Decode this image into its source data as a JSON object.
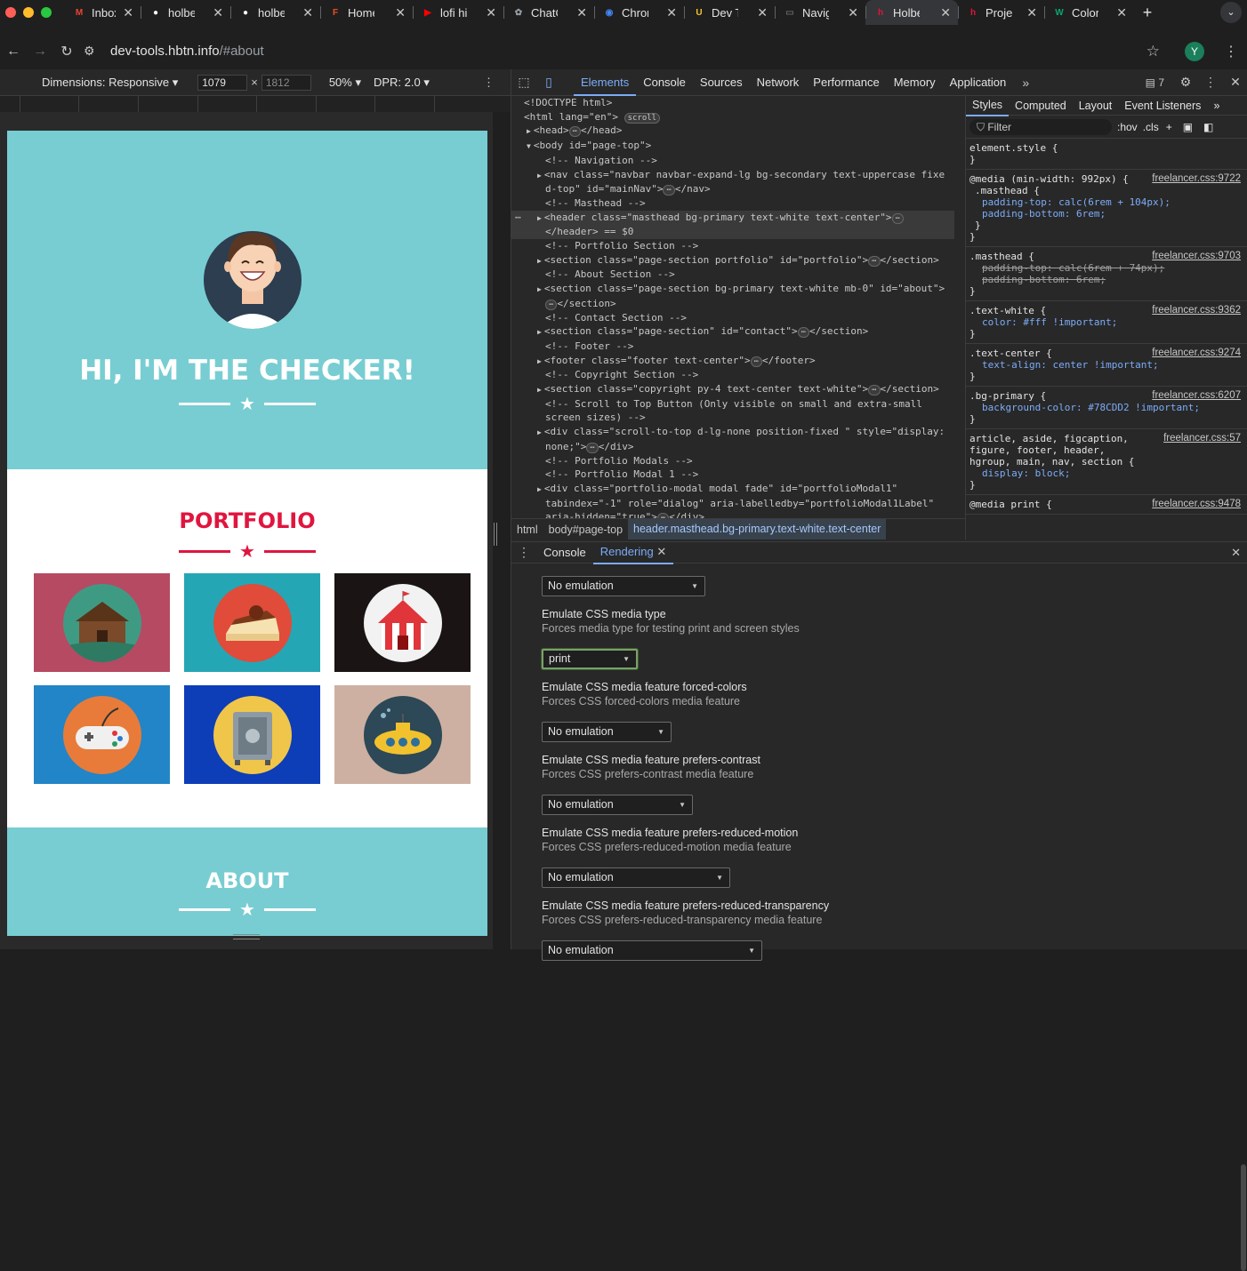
{
  "browser": {
    "tabs": [
      {
        "title": "Inbox",
        "icon": "gmail-icon",
        "color": "#ea4335",
        "glyph": "M"
      },
      {
        "title": "holbe",
        "icon": "github-icon",
        "color": "#ffffff",
        "glyph": "●"
      },
      {
        "title": "holbe",
        "icon": "github-icon",
        "color": "#ffffff",
        "glyph": "●"
      },
      {
        "title": "Home",
        "icon": "figma-icon",
        "color": "#f24e1e",
        "glyph": "F"
      },
      {
        "title": "lofi hi",
        "icon": "youtube-icon",
        "color": "#ff0000",
        "glyph": "▶"
      },
      {
        "title": "ChatC",
        "icon": "openai-icon",
        "color": "#9aa0a6",
        "glyph": "✿"
      },
      {
        "title": "Chror",
        "icon": "chrome-icon",
        "color": "#4285f4",
        "glyph": "◉"
      },
      {
        "title": "Dev T",
        "icon": "udemy-icon",
        "color": "#f4c430",
        "glyph": "U"
      },
      {
        "title": "Navig",
        "icon": "book-icon",
        "color": "#5f6368",
        "glyph": "▭"
      },
      {
        "title": "Holbe",
        "icon": "holberton-icon",
        "color": "#e0153f",
        "glyph": "h",
        "active": true
      },
      {
        "title": "Proje",
        "icon": "holberton-icon",
        "color": "#e0153f",
        "glyph": "h"
      },
      {
        "title": "Color",
        "icon": "w3-icon",
        "color": "#04aa6d",
        "glyph": "W"
      }
    ],
    "new_tab": "+",
    "url_host": "dev-tools.hbtn.info",
    "url_path": "/#about",
    "profile": "Y"
  },
  "device_toolbar": {
    "dimensions_label": "Dimensions: Responsive",
    "width": "1079",
    "times": "×",
    "height": "1812",
    "zoom": "50%",
    "dpr": "DPR: 2.0"
  },
  "site": {
    "hero_title": "HI, I'M THE CHECKER!",
    "portfolio_title": "PORTFOLIO",
    "about_title": "ABOUT",
    "colors": {
      "primary": "#78CDD2",
      "secondary": "#E0153F"
    },
    "tiles": [
      {
        "name": "cabin",
        "bg": "#b64a62",
        "circle": "#3f9a84"
      },
      {
        "name": "cake",
        "bg": "#25a6b5",
        "circle": "#e04b3a"
      },
      {
        "name": "circus",
        "bg": "#1a1414",
        "circle": "#f2f2f2"
      },
      {
        "name": "game-controller",
        "bg": "#2285c7",
        "circle": "#e87b3a"
      },
      {
        "name": "safe",
        "bg": "#0e3db8",
        "circle": "#f0c64a"
      },
      {
        "name": "submarine",
        "bg": "#cdb0a2",
        "circle": "#2d4856"
      }
    ]
  },
  "devtools": {
    "main_tabs": [
      "Elements",
      "Console",
      "Sources",
      "Network",
      "Performance",
      "Memory",
      "Application"
    ],
    "issues_count": "7",
    "dom_lines": [
      "<!DOCTYPE html>",
      "<html lang=\"en\">",
      "<head>",
      "</head>",
      "<body id=\"page-top\">",
      "<!-- Navigation -->",
      "<nav class=\"navbar navbar-expand-lg bg-secondary text-uppercase fixe",
      "d-top\" id=\"mainNav\">",
      "</nav>",
      "<!-- Masthead -->",
      "<header class=\"masthead bg-primary text-white text-center\">",
      "</header> == $0",
      "<!-- Portfolio Section -->",
      "<section class=\"page-section portfolio\" id=\"portfolio\">",
      "</section>",
      "<!-- About Section -->",
      "<section class=\"page-section bg-primary text-white mb-0\" id=\"about\">",
      "</section>",
      "<!-- Contact Section -->",
      "<section class=\"page-section\" id=\"contact\">",
      "</section>",
      "<!-- Footer -->",
      "<footer class=\"footer text-center\">",
      "</footer>",
      "<!-- Copyright Section -->",
      "<section class=\"copyright py-4 text-center text-white\">",
      "</section>",
      "<!-- Scroll to Top Button (Only visible on small and extra-small",
      "screen sizes) -->",
      "<div class=\"scroll-to-top d-lg-none position-fixed \" style=\"display:",
      "none;\">",
      "</div>",
      "<!-- Portfolio Modals -->",
      "<!-- Portfolio Modal 1 -->",
      "<div class=\"portfolio-modal modal fade\" id=\"portfolioModal1\"",
      "tabindex=\"-1\" role=\"dialog\" aria-labelledby=\"portfolioModal1Label\"",
      "aria-hidden=\"true\">",
      "</div>"
    ],
    "scroll_badge": "scroll",
    "breadcrumbs": [
      "html",
      "body#page-top",
      "header.masthead.bg-primary.text-white.text-center"
    ],
    "styles_tabs": [
      "Styles",
      "Computed",
      "Layout",
      "Event Listeners"
    ],
    "filter_placeholder": "Filter",
    "hov": ":hov",
    "cls": ".cls",
    "rules": [
      {
        "selector": "element.style {",
        "source": "",
        "lines": [
          "}"
        ]
      },
      {
        "selector": "@media (min-width: 992px) {",
        "source": "freelancer.css:9722",
        "lines": [
          ".masthead {",
          "padding-top: calc(6rem + 104px);",
          "padding-bottom: 6rem;",
          "}",
          "}"
        ]
      },
      {
        "selector": ".masthead {",
        "source": "freelancer.css:9703",
        "lines": [
          "padding-top: calc(6rem + 74px);",
          "padding-bottom: 6rem;",
          "}"
        ]
      },
      {
        "selector": ".text-white {",
        "source": "freelancer.css:9362",
        "lines": [
          "color: #fff !important;",
          "}"
        ]
      },
      {
        "selector": ".text-center {",
        "source": "freelancer.css:9274",
        "lines": [
          "text-align: center !important;",
          "}"
        ]
      },
      {
        "selector": ".bg-primary {",
        "source": "freelancer.css:6207",
        "lines": [
          "background-color: #78CDD2 !important;",
          "}"
        ]
      },
      {
        "selector": "article, aside, figcaption, figure, footer, header, hgroup, main, nav, section {",
        "source": "freelancer.css:57",
        "lines": [
          "display: block;",
          "}"
        ]
      },
      {
        "selector": "@media print {",
        "source": "freelancer.css:9478",
        "lines": []
      }
    ],
    "drawer_tabs": [
      "Console",
      "Rendering"
    ],
    "rendering": [
      {
        "label": "",
        "sub": "",
        "value": "No emulation"
      },
      {
        "label": "Emulate CSS media type",
        "sub": "Forces media type for testing print and screen styles",
        "value": "print"
      },
      {
        "label": "Emulate CSS media feature forced-colors",
        "sub": "Forces CSS forced-colors media feature",
        "value": "No emulation"
      },
      {
        "label": "Emulate CSS media feature prefers-contrast",
        "sub": "Forces CSS prefers-contrast media feature",
        "value": "No emulation"
      },
      {
        "label": "Emulate CSS media feature prefers-reduced-motion",
        "sub": "Forces CSS prefers-reduced-motion media feature",
        "value": "No emulation"
      },
      {
        "label": "Emulate CSS media feature prefers-reduced-transparency",
        "sub": "Forces CSS prefers-reduced-transparency media feature",
        "value": "No emulation"
      }
    ]
  }
}
